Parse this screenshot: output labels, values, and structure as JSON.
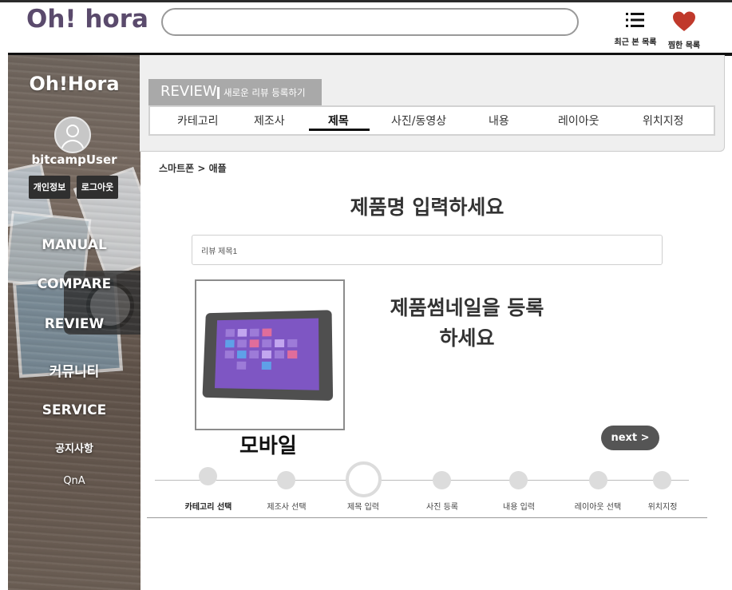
{
  "header": {
    "logo": "Oh! hora",
    "search_placeholder": "",
    "recent_label": "최근 본 목록",
    "wishlist_label": "찜한 목록"
  },
  "sidebar": {
    "title": "Oh!Hora",
    "username": "bitcampUser",
    "profile_button": "개인정보",
    "logout_button": "로그아웃",
    "menu": [
      "MANUAL",
      "COMPARE",
      "REVIEW",
      "커뮤니티",
      "SERVICE",
      "공지사항",
      "QnA"
    ]
  },
  "review_panel": {
    "tag": "REVIEW",
    "subtitle": "새로운 리뷰 등록하기",
    "tabs": [
      "카테고리",
      "제조사",
      "제목",
      "사진/동영상",
      "내용",
      "레이아웃",
      "위치지정"
    ],
    "active_tab": "제목"
  },
  "content": {
    "breadcrumb": "스마트폰 > 애플",
    "heading": "제품명 입력하세요",
    "title_input_value": "리뷰 제목1",
    "thumbnail_line1": "제품썸네일을 등록",
    "thumbnail_line2": "하세요",
    "category_label": "모바일",
    "next_button": "next >"
  },
  "steps": {
    "labels": [
      "카테고리 선택",
      "제조사 선택",
      "제목 입력",
      "사진 등록",
      "내용 입력",
      "레이아웃 선택",
      "위치지정"
    ],
    "current": "제목 입력"
  },
  "colors": {
    "logo": "#5a4a6c",
    "heart": "#c0392b",
    "next_button": "#555555",
    "review_tag": "#a9a9a9"
  }
}
